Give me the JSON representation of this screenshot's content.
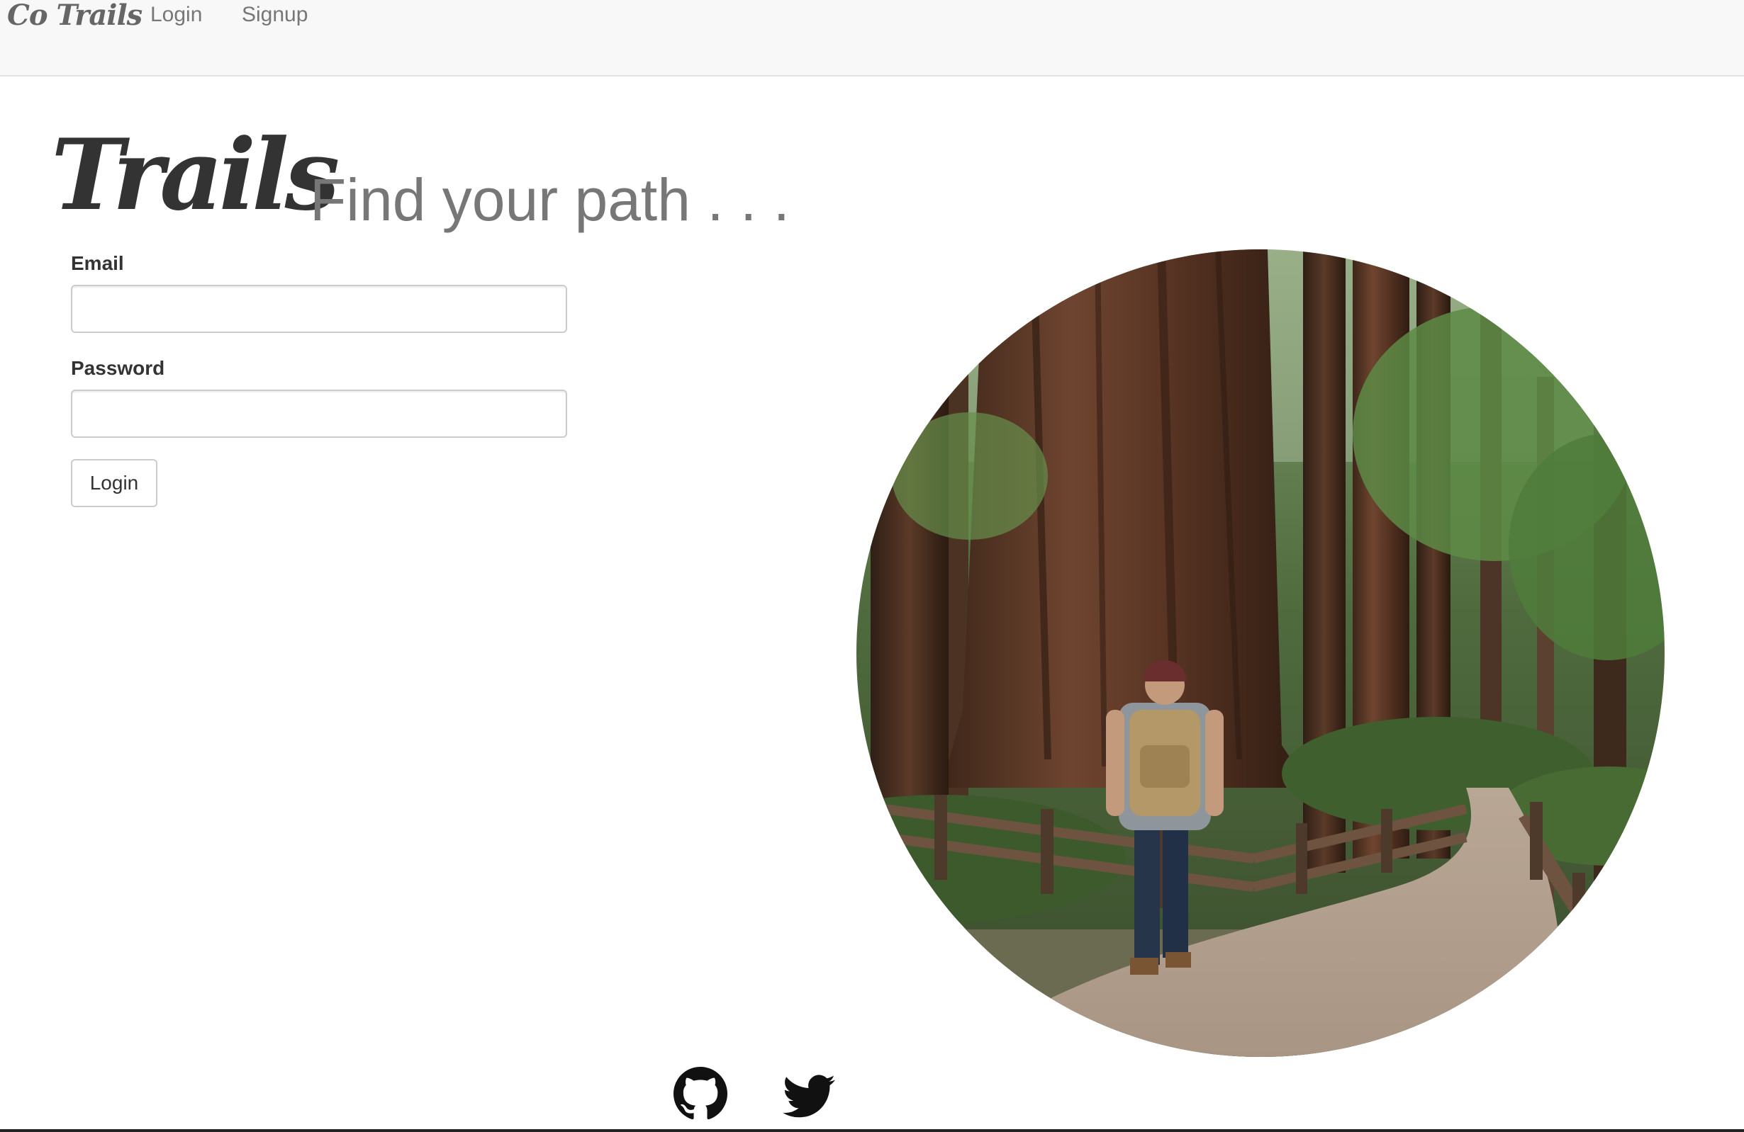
{
  "navbar": {
    "brand": "Co Trails",
    "links": [
      {
        "label": "Login"
      },
      {
        "label": "Signup"
      }
    ]
  },
  "hero": {
    "title": "Trails",
    "tagline": "Find your path . . ."
  },
  "login_form": {
    "email_label": "Email",
    "email_value": "",
    "password_label": "Password",
    "password_value": "",
    "submit_label": "Login"
  },
  "footer": {
    "icons": [
      "github-icon",
      "twitter-icon"
    ]
  },
  "colors": {
    "navbar_bg": "#f8f8f8",
    "nav_link": "#777777",
    "heading": "#333333",
    "tagline": "#777777"
  }
}
